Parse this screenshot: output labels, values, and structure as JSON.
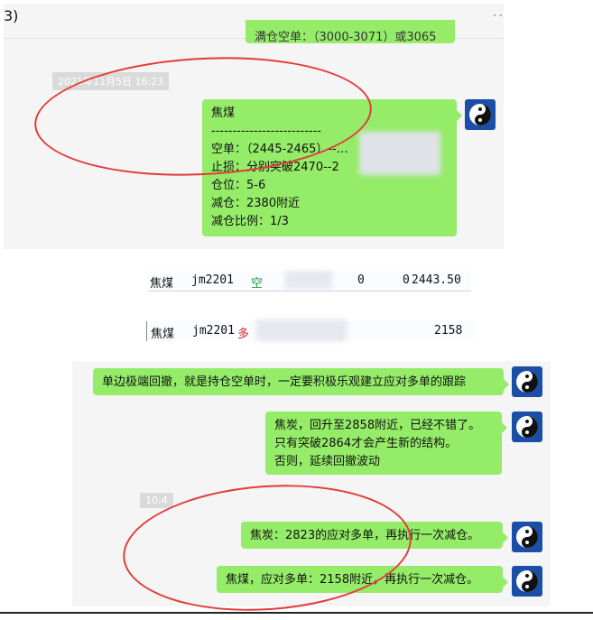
{
  "top_panel": {
    "corner_label": "3)",
    "menu_dots": "··",
    "partial_bubble_text": "满仓空单：（3000-3071）或3065",
    "timestamp": "2021年11月5日 16:23",
    "message": {
      "title": "焦煤",
      "divider": "--------------------------",
      "lines": [
        "空单：（2445-2465）--…",
        "止损：分别突破2470--2",
        "仓位：5-6",
        "减仓：2380附近",
        "减仓比例：1/3"
      ]
    }
  },
  "positions": [
    {
      "name": "焦煤",
      "code": "jm2201",
      "side": "空",
      "side_color": "#1a9b3c",
      "col4": "0",
      "col5": "0",
      "price": "2443.50"
    },
    {
      "name": "焦煤",
      "code": "jm2201",
      "side": "多",
      "side_color": "#d62828",
      "col4": "",
      "col5": "",
      "price": "2158"
    }
  ],
  "bottom_panel": {
    "messages": [
      "单边极端回撤，就是持仓空单时，一定要积极乐观建立应对多单的跟踪",
      [
        "焦炭，回升至2858附近，已经不错了。",
        "只有突破2864才会产生新的结构。",
        "否则，延续回撤波动"
      ],
      "焦炭：2823的应对多单，再执行一次减仓。",
      "焦煤，应对多单：2158附近，再执行一次减仓。"
    ],
    "timestamp": "10:4"
  },
  "colors": {
    "bubble": "#95ec69",
    "panel": "#f5f5f5",
    "ellipse": "#e23b3b",
    "avatar": "#1b4ea6"
  }
}
